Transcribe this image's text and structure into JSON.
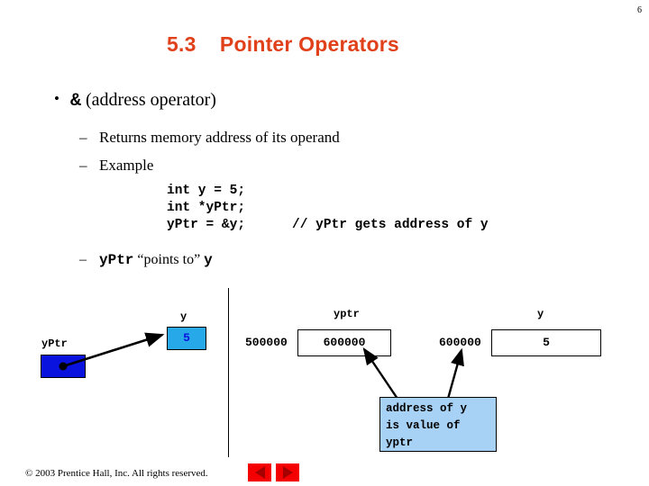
{
  "slide": {
    "page_number": "6",
    "title": "5.3    Pointer Operators"
  },
  "bullets": {
    "level1_symbol": "&",
    "level1_text": " (address operator)",
    "level2": [
      "Returns memory address of its operand",
      "Example"
    ],
    "points_to_prefix": "yPtr",
    "points_to_middle": " “points to” ",
    "points_to_suffix": "y"
  },
  "code": {
    "line1": "int y = 5;",
    "line2": "int *yPtr;",
    "line3": "yPtr = &y;",
    "line3_comment": "// yPtr gets address of y"
  },
  "diagram_left": {
    "pointer_label": "yPtr",
    "variable_label": "y",
    "variable_value": "5",
    "pointer_box_color": "#0a13de",
    "variable_box_color": "#27a8e8"
  },
  "diagram_right": {
    "yptr_address": "500000",
    "yptr_label": "yptr",
    "yptr_value": "600000",
    "y_address": "600000",
    "y_label": "y",
    "y_value": "5",
    "annotation_line1": "address of y",
    "annotation_line2": "is value of",
    "annotation_line3": "yptr",
    "annotation_box_color": "#a8d2f5"
  },
  "footer": {
    "copyright": "© 2003 Prentice Hall, Inc.  All rights reserved.",
    "prev_icon": "triangle-left-icon",
    "next_icon": "triangle-right-icon",
    "nav_color": "#f40000"
  }
}
